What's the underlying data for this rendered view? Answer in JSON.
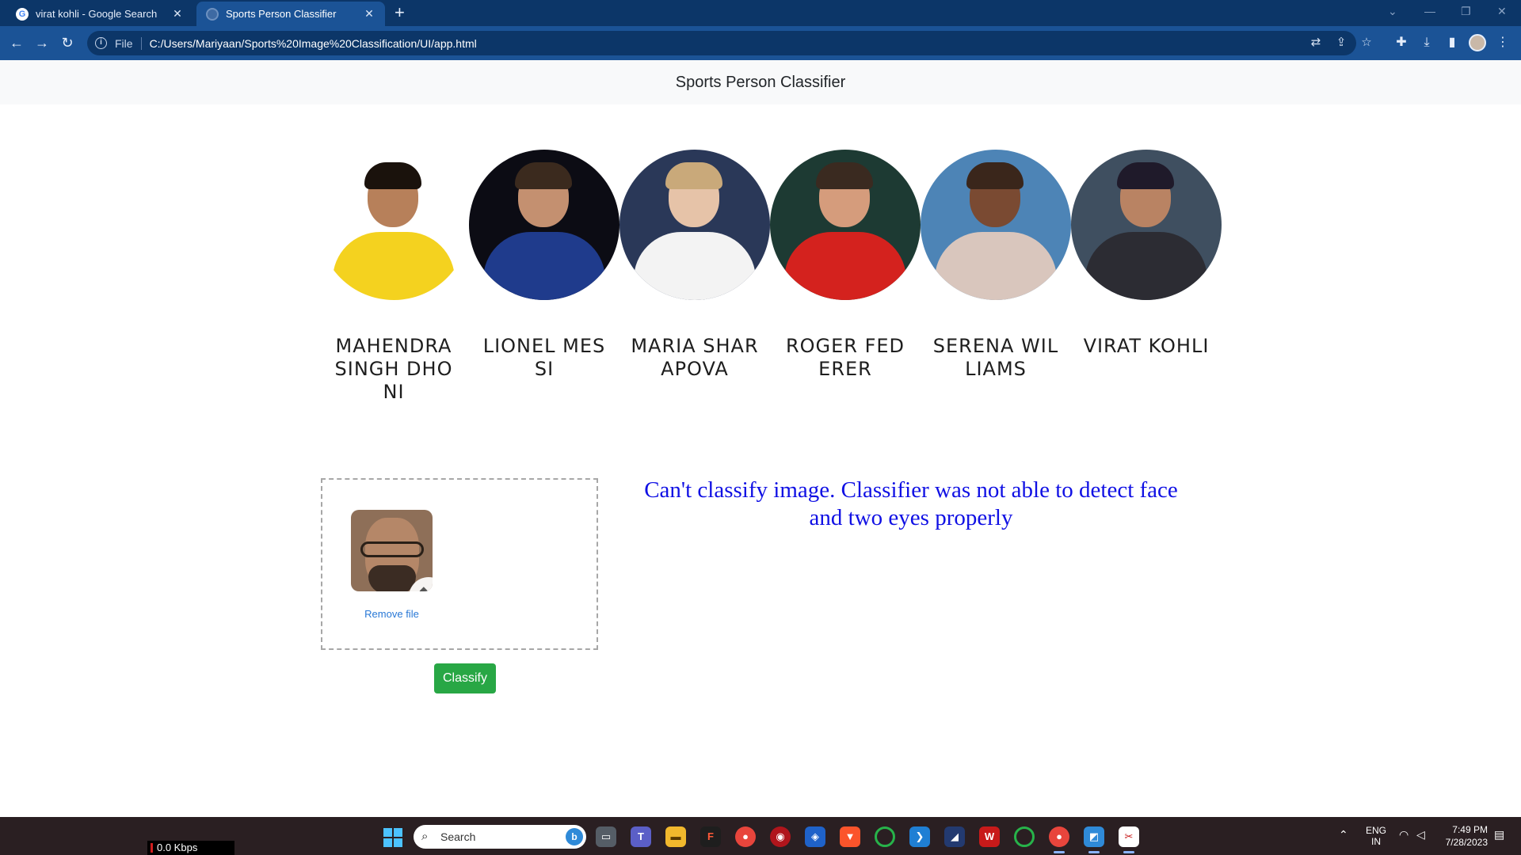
{
  "browser": {
    "tabs": [
      {
        "title": "virat kohli - Google Search",
        "favicon": "google-icon"
      },
      {
        "title": "Sports Person Classifier",
        "favicon": "globe-icon"
      }
    ],
    "url_scheme": "File",
    "url": "C:/Users/Mariyaan/Sports%20Image%20Classification/UI/app.html"
  },
  "page": {
    "title": "Sports Person Classifier",
    "players": [
      {
        "name": "MAHENDRA SINGH DHONI",
        "skin": "#b7805a",
        "hair": "#1a120c",
        "shirt": "#f4d21f",
        "bg": "#ffffff"
      },
      {
        "name": "LIONEL MESSI",
        "skin": "#c49070",
        "hair": "#3b2a1e",
        "shirt": "#1f3b8c",
        "bg": "#0c0c14"
      },
      {
        "name": "MARIA SHARAPOVA",
        "skin": "#e6c3a8",
        "hair": "#c9a97a",
        "shirt": "#f3f3f3",
        "bg": "#2a3858"
      },
      {
        "name": "ROGER FEDERER",
        "skin": "#d59c7c",
        "hair": "#3a2a20",
        "shirt": "#d4221e",
        "bg": "#1d3a33"
      },
      {
        "name": "SERENA WILLIAMS",
        "skin": "#7a4a32",
        "hair": "#3a261b",
        "shirt": "#d9c6bd",
        "bg": "#4d84b6"
      },
      {
        "name": "VIRAT KOHLI",
        "skin": "#b98363",
        "hair": "#1f1a2a",
        "shirt": "#2c2c33",
        "bg": "#3f4f60"
      }
    ],
    "dropzone": {
      "remove_label": "Remove file"
    },
    "classify_label": "Classify",
    "error_message": "Can't classify image. Classifier was not able to detect face and two eyes properly"
  },
  "taskbar": {
    "net_speed": "0.0 Kbps",
    "search_placeholder": "Search",
    "lang_top": "ENG",
    "lang_bottom": "IN",
    "time": "7:49 PM",
    "date": "7/28/2023"
  },
  "colors": {
    "error_text": "#1010e4",
    "classify_button": "#28a745",
    "link": "#2878d6"
  }
}
